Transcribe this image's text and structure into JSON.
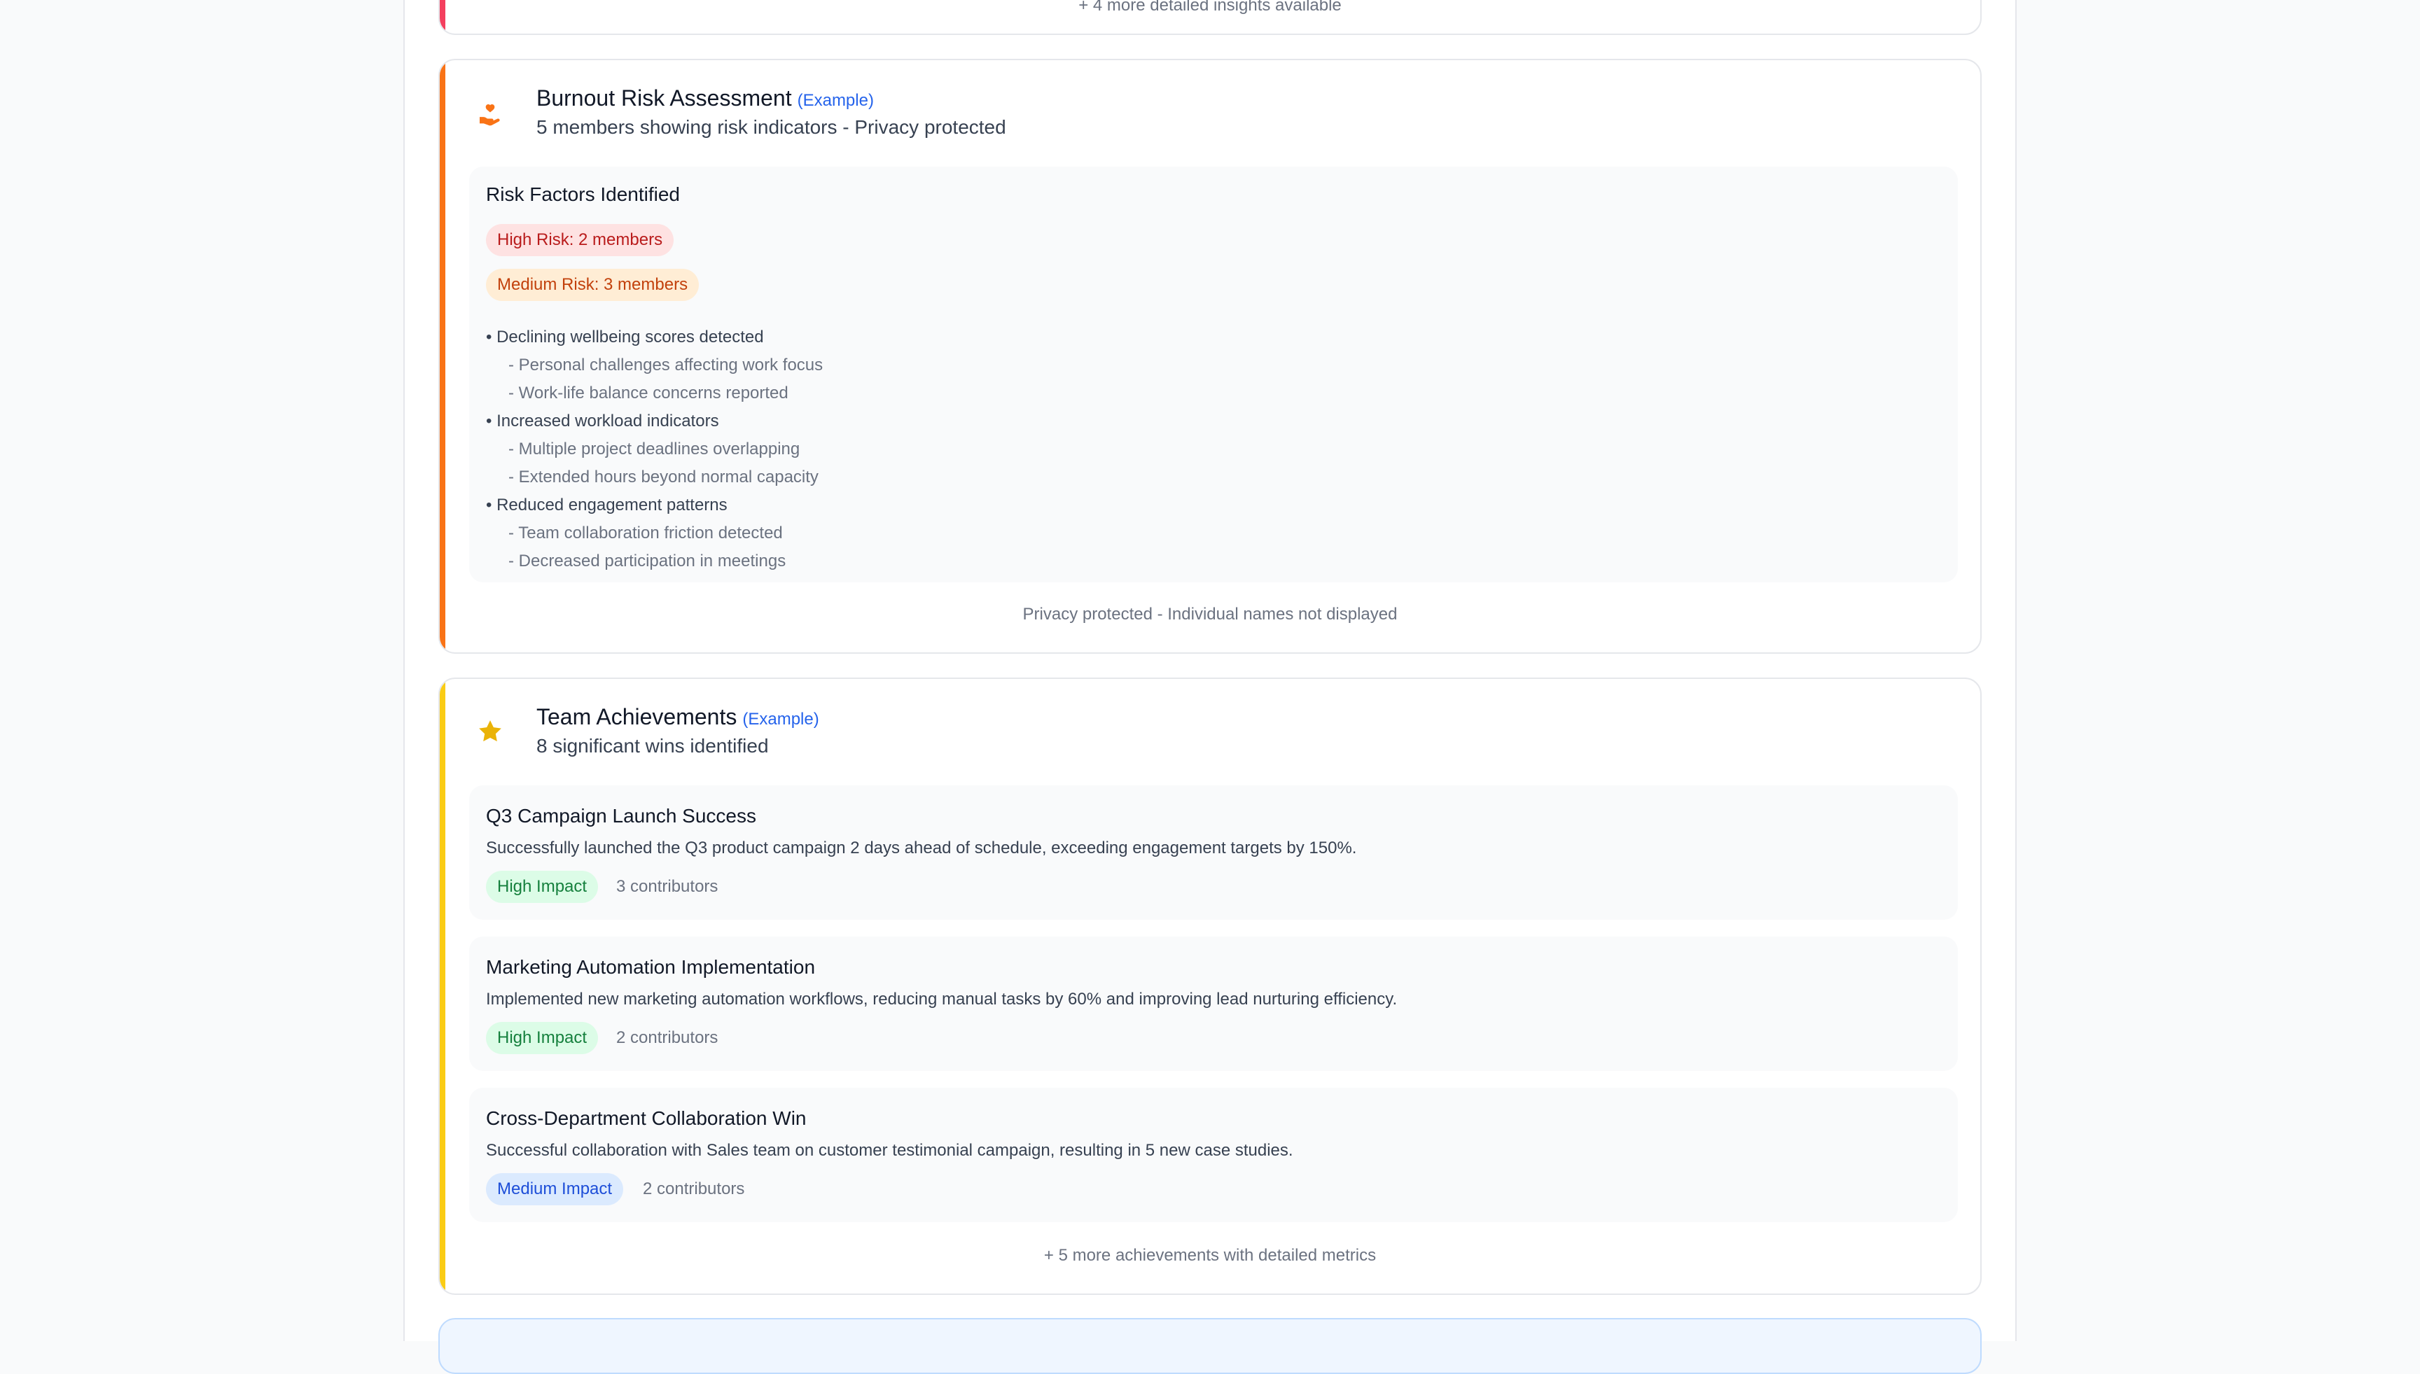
{
  "top_card": {
    "more_text": "+ 4 more detailed insights available",
    "accent_color": "#f43f5e"
  },
  "burnout": {
    "icon": "hand-heart-icon",
    "accent_color": "#f97316",
    "title": "Burnout Risk Assessment",
    "example_tag": "(Example)",
    "subtitle": "5 members showing risk indicators - Privacy protected",
    "panel_heading": "Risk Factors Identified",
    "high_risk": "High Risk: 2 members",
    "medium_risk": "Medium Risk: 3 members",
    "factors": [
      {
        "label": "• Declining wellbeing scores detected",
        "details": [
          "- Personal challenges affecting work focus",
          "- Work-life balance concerns reported"
        ]
      },
      {
        "label": "• Increased workload indicators",
        "details": [
          "- Multiple project deadlines overlapping",
          "- Extended hours beyond normal capacity"
        ]
      },
      {
        "label": "• Reduced engagement patterns",
        "details": [
          "- Team collaboration friction detected",
          "- Decreased participation in meetings"
        ]
      }
    ],
    "footer": "Privacy protected - Individual names not displayed"
  },
  "achievements": {
    "icon": "star-icon",
    "accent_color": "#facc15",
    "title": "Team Achievements",
    "example_tag": "(Example)",
    "subtitle": "8 significant wins identified",
    "items": [
      {
        "title": "Q3 Campaign Launch Success",
        "description": "Successfully launched the Q3 product campaign 2 days ahead of schedule, exceeding engagement targets by 150%.",
        "impact": "High Impact",
        "contributors": "3 contributors"
      },
      {
        "title": "Marketing Automation Implementation",
        "description": "Implemented new marketing automation workflows, reducing manual tasks by 60% and improving lead nurturing efficiency.",
        "impact": "High Impact",
        "contributors": "2 contributors"
      },
      {
        "title": "Cross-Department Collaboration Win",
        "description": "Successful collaboration with Sales team on customer testimonial campaign, resulting in 5 new case studies.",
        "impact": "Medium Impact",
        "contributors": "2 contributors"
      }
    ],
    "footer": "+ 5 more achievements with detailed metrics"
  }
}
